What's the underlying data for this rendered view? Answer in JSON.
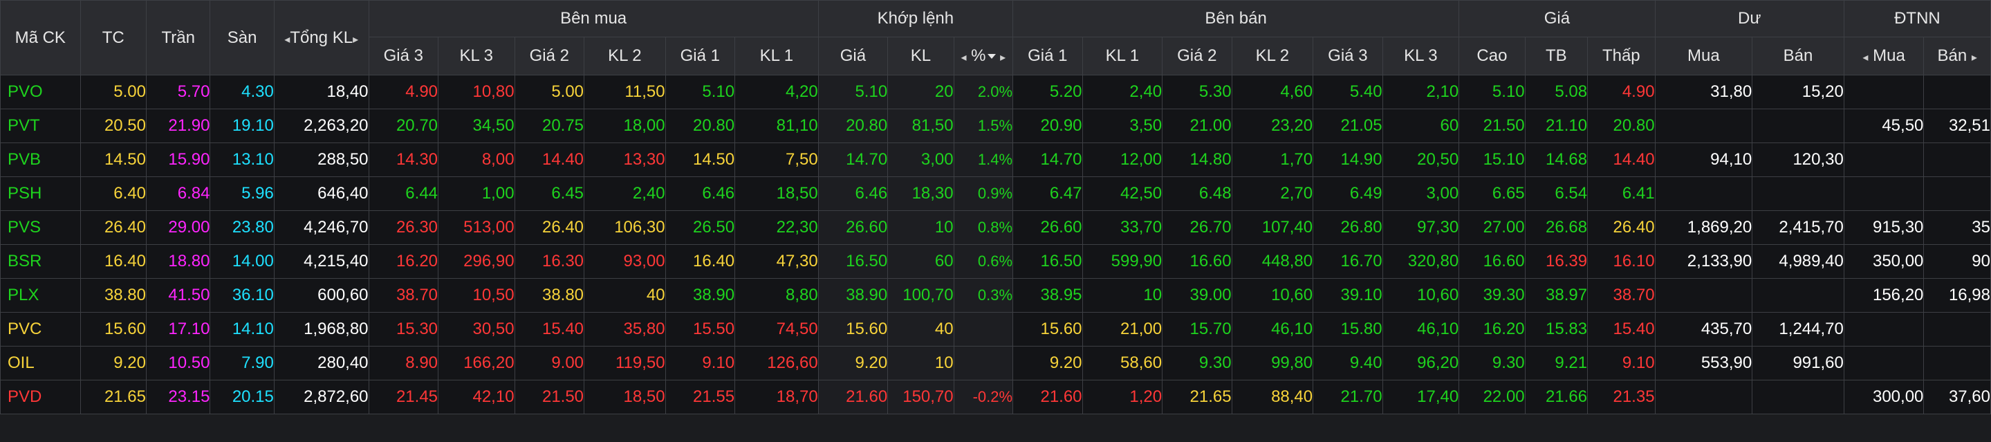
{
  "colors": {
    "up": "#1ed31e",
    "down": "#ff3737",
    "ref": "#f7d33a",
    "ceil": "#ff25ff",
    "floor": "#1ee0ff",
    "neutral": "#ffffff"
  },
  "header": {
    "ma_ck": "Mã CK",
    "tc": "TC",
    "tran": "Trần",
    "san": "Sàn",
    "tong_kl": "Tổng KL",
    "ben_mua": "Bên mua",
    "khop_lenh": "Khớp lệnh",
    "ben_ban": "Bên bán",
    "gia": "Giá",
    "du": "Dư",
    "dtnn": "ĐTNN",
    "sub": {
      "buy_g3": "Giá 3",
      "buy_kl3": "KL 3",
      "buy_g2": "Giá 2",
      "buy_kl2": "KL 2",
      "buy_g1": "Giá 1",
      "buy_kl1": "KL 1",
      "match_gia": "Giá",
      "match_kl": "KL",
      "match_pct": "%",
      "sell_g1": "Giá 1",
      "sell_kl1": "KL 1",
      "sell_g2": "Giá 2",
      "sell_kl2": "KL 2",
      "sell_g3": "Giá 3",
      "sell_kl3": "KL 3",
      "cao": "Cao",
      "tb": "TB",
      "thap": "Thấp",
      "du_mua": "Mua",
      "du_ban": "Bán",
      "nn_mua": "Mua",
      "nn_ban": "Bán"
    },
    "arrows": {
      "left": "◂",
      "right": "▸"
    }
  },
  "rows": [
    {
      "sym": "PVO",
      "sym_c": "up",
      "tc": "5.00",
      "tran": "5.70",
      "san": "4.30",
      "tongkl": "18,40",
      "b3": "4.90",
      "b3c": "down",
      "bk3": "10,80",
      "b2": "5.00",
      "b2c": "ref",
      "bk2": "11,50",
      "b1": "5.10",
      "b1c": "up",
      "bk1": "4,20",
      "mg": "5.10",
      "mk": "20",
      "mp": "2.0%",
      "mc": "up",
      "s1": "5.20",
      "s1c": "up",
      "sk1": "2,40",
      "s2": "5.30",
      "s2c": "up",
      "sk2": "4,60",
      "s3": "5.40",
      "s3c": "up",
      "sk3": "2,10",
      "cao": "5.10",
      "caoc": "up",
      "tb": "5.08",
      "tbc": "up",
      "thap": "4.90",
      "thapc": "down",
      "dmua": "31,80",
      "dban": "15,20",
      "nnmua": "",
      "nnban": ""
    },
    {
      "sym": "PVT",
      "sym_c": "up",
      "tc": "20.50",
      "tran": "21.90",
      "san": "19.10",
      "tongkl": "2,263,20",
      "b3": "20.70",
      "b3c": "up",
      "bk3": "34,50",
      "b2": "20.75",
      "b2c": "up",
      "bk2": "18,00",
      "b1": "20.80",
      "b1c": "up",
      "bk1": "81,10",
      "mg": "20.80",
      "mk": "81,50",
      "mp": "1.5%",
      "mc": "up",
      "s1": "20.90",
      "s1c": "up",
      "sk1": "3,50",
      "s2": "21.00",
      "s2c": "up",
      "sk2": "23,20",
      "s3": "21.05",
      "s3c": "up",
      "sk3": "60",
      "cao": "21.50",
      "caoc": "up",
      "tb": "21.10",
      "tbc": "up",
      "thap": "20.80",
      "thapc": "up",
      "dmua": "",
      "dban": "",
      "nnmua": "45,50",
      "nnban": "32,51"
    },
    {
      "sym": "PVB",
      "sym_c": "up",
      "tc": "14.50",
      "tran": "15.90",
      "san": "13.10",
      "tongkl": "288,50",
      "b3": "14.30",
      "b3c": "down",
      "bk3": "8,00",
      "b2": "14.40",
      "b2c": "down",
      "bk2": "13,30",
      "b1": "14.50",
      "b1c": "ref",
      "bk1": "7,50",
      "mg": "14.70",
      "mk": "3,00",
      "mp": "1.4%",
      "mc": "up",
      "s1": "14.70",
      "s1c": "up",
      "sk1": "12,00",
      "s2": "14.80",
      "s2c": "up",
      "sk2": "1,70",
      "s3": "14.90",
      "s3c": "up",
      "sk3": "20,50",
      "cao": "15.10",
      "caoc": "up",
      "tb": "14.68",
      "tbc": "up",
      "thap": "14.40",
      "thapc": "down",
      "dmua": "94,10",
      "dban": "120,30",
      "nnmua": "",
      "nnban": ""
    },
    {
      "sym": "PSH",
      "sym_c": "up",
      "tc": "6.40",
      "tran": "6.84",
      "san": "5.96",
      "tongkl": "646,40",
      "b3": "6.44",
      "b3c": "up",
      "bk3": "1,00",
      "b2": "6.45",
      "b2c": "up",
      "bk2": "2,40",
      "b1": "6.46",
      "b1c": "up",
      "bk1": "18,50",
      "mg": "6.46",
      "mk": "18,30",
      "mp": "0.9%",
      "mc": "up",
      "s1": "6.47",
      "s1c": "up",
      "sk1": "42,50",
      "s2": "6.48",
      "s2c": "up",
      "sk2": "2,70",
      "s3": "6.49",
      "s3c": "up",
      "sk3": "3,00",
      "cao": "6.65",
      "caoc": "up",
      "tb": "6.54",
      "tbc": "up",
      "thap": "6.41",
      "thapc": "up",
      "dmua": "",
      "dban": "",
      "nnmua": "",
      "nnban": ""
    },
    {
      "sym": "PVS",
      "sym_c": "up",
      "tc": "26.40",
      "tran": "29.00",
      "san": "23.80",
      "tongkl": "4,246,70",
      "b3": "26.30",
      "b3c": "down",
      "bk3": "513,00",
      "b2": "26.40",
      "b2c": "ref",
      "bk2": "106,30",
      "b1": "26.50",
      "b1c": "up",
      "bk1": "22,30",
      "mg": "26.60",
      "mk": "10",
      "mp": "0.8%",
      "mc": "up",
      "s1": "26.60",
      "s1c": "up",
      "sk1": "33,70",
      "s2": "26.70",
      "s2c": "up",
      "sk2": "107,40",
      "s3": "26.80",
      "s3c": "up",
      "sk3": "97,30",
      "cao": "27.00",
      "caoc": "up",
      "tb": "26.68",
      "tbc": "up",
      "thap": "26.40",
      "thapc": "ref",
      "dmua": "1,869,20",
      "dban": "2,415,70",
      "nnmua": "915,30",
      "nnban": "35"
    },
    {
      "sym": "BSR",
      "sym_c": "up",
      "tc": "16.40",
      "tran": "18.80",
      "san": "14.00",
      "tongkl": "4,215,40",
      "b3": "16.20",
      "b3c": "down",
      "bk3": "296,90",
      "b2": "16.30",
      "b2c": "down",
      "bk2": "93,00",
      "b1": "16.40",
      "b1c": "ref",
      "bk1": "47,30",
      "mg": "16.50",
      "mk": "60",
      "mp": "0.6%",
      "mc": "up",
      "s1": "16.50",
      "s1c": "up",
      "sk1": "599,90",
      "s2": "16.60",
      "s2c": "up",
      "sk2": "448,80",
      "s3": "16.70",
      "s3c": "up",
      "sk3": "320,80",
      "cao": "16.60",
      "caoc": "up",
      "tb": "16.39",
      "tbc": "down",
      "thap": "16.10",
      "thapc": "down",
      "dmua": "2,133,90",
      "dban": "4,989,40",
      "nnmua": "350,00",
      "nnban": "90"
    },
    {
      "sym": "PLX",
      "sym_c": "up",
      "tc": "38.80",
      "tran": "41.50",
      "san": "36.10",
      "tongkl": "600,60",
      "b3": "38.70",
      "b3c": "down",
      "bk3": "10,50",
      "b2": "38.80",
      "b2c": "ref",
      "bk2": "40",
      "b1": "38.90",
      "b1c": "up",
      "bk1": "8,80",
      "mg": "38.90",
      "mk": "100,70",
      "mp": "0.3%",
      "mc": "up",
      "s1": "38.95",
      "s1c": "up",
      "sk1": "10",
      "s2": "39.00",
      "s2c": "up",
      "sk2": "10,60",
      "s3": "39.10",
      "s3c": "up",
      "sk3": "10,60",
      "cao": "39.30",
      "caoc": "up",
      "tb": "38.97",
      "tbc": "up",
      "thap": "38.70",
      "thapc": "down",
      "dmua": "",
      "dban": "",
      "nnmua": "156,20",
      "nnban": "16,98"
    },
    {
      "sym": "PVC",
      "sym_c": "ref",
      "tc": "15.60",
      "tran": "17.10",
      "san": "14.10",
      "tongkl": "1,968,80",
      "b3": "15.30",
      "b3c": "down",
      "bk3": "30,50",
      "b2": "15.40",
      "b2c": "down",
      "bk2": "35,80",
      "b1": "15.50",
      "b1c": "down",
      "bk1": "74,50",
      "mg": "15.60",
      "mk": "40",
      "mp": "",
      "mc": "ref",
      "s1": "15.60",
      "s1c": "ref",
      "sk1": "21,00",
      "s2": "15.70",
      "s2c": "up",
      "sk2": "46,10",
      "s3": "15.80",
      "s3c": "up",
      "sk3": "46,10",
      "cao": "16.20",
      "caoc": "up",
      "tb": "15.83",
      "tbc": "up",
      "thap": "15.40",
      "thapc": "down",
      "dmua": "435,70",
      "dban": "1,244,70",
      "nnmua": "",
      "nnban": ""
    },
    {
      "sym": "OIL",
      "sym_c": "ref",
      "tc": "9.20",
      "tran": "10.50",
      "san": "7.90",
      "tongkl": "280,40",
      "b3": "8.90",
      "b3c": "down",
      "bk3": "166,20",
      "b2": "9.00",
      "b2c": "down",
      "bk2": "119,50",
      "b1": "9.10",
      "b1c": "down",
      "bk1": "126,60",
      "mg": "9.20",
      "mk": "10",
      "mp": "",
      "mc": "ref",
      "s1": "9.20",
      "s1c": "ref",
      "sk1": "58,60",
      "s2": "9.30",
      "s2c": "up",
      "sk2": "99,80",
      "s3": "9.40",
      "s3c": "up",
      "sk3": "96,20",
      "cao": "9.30",
      "caoc": "up",
      "tb": "9.21",
      "tbc": "up",
      "thap": "9.10",
      "thapc": "down",
      "dmua": "553,90",
      "dban": "991,60",
      "nnmua": "",
      "nnban": ""
    },
    {
      "sym": "PVD",
      "sym_c": "down",
      "tc": "21.65",
      "tran": "23.15",
      "san": "20.15",
      "tongkl": "2,872,60",
      "b3": "21.45",
      "b3c": "down",
      "bk3": "42,10",
      "b2": "21.50",
      "b2c": "down",
      "bk2": "18,50",
      "b1": "21.55",
      "b1c": "down",
      "bk1": "18,70",
      "mg": "21.60",
      "mk": "150,70",
      "mp": "-0.2%",
      "mc": "down",
      "s1": "21.60",
      "s1c": "down",
      "sk1": "1,20",
      "s2": "21.65",
      "s2c": "ref",
      "sk2": "88,40",
      "s3": "21.70",
      "s3c": "up",
      "sk3": "17,40",
      "cao": "22.00",
      "caoc": "up",
      "tb": "21.66",
      "tbc": "up",
      "thap": "21.35",
      "thapc": "down",
      "dmua": "",
      "dban": "",
      "nnmua": "300,00",
      "nnban": "37,60"
    }
  ]
}
